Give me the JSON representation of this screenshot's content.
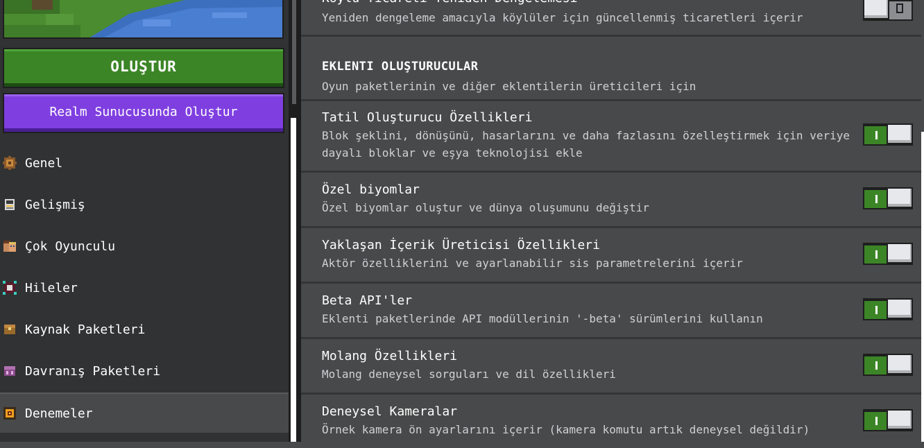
{
  "left_panel": {
    "create_button": "OLUŞTUR",
    "realm_button": "Realm Sunucusunda Oluştur",
    "nav": [
      {
        "label": "Genel",
        "icon": "gear-icon",
        "active": false
      },
      {
        "label": "Gelişmiş",
        "icon": "advanced-icon",
        "active": false
      },
      {
        "label": "Çok Oyunculu",
        "icon": "multiplayer-icon",
        "active": false
      },
      {
        "label": "Hileler",
        "icon": "cheats-icon",
        "active": false
      },
      {
        "label": "Kaynak Paketleri",
        "icon": "resource-pack-icon",
        "active": false
      },
      {
        "label": "Davranış Paketleri",
        "icon": "behavior-pack-icon",
        "active": false
      },
      {
        "label": "Denemeler",
        "icon": "experiments-icon",
        "active": true
      }
    ]
  },
  "right_panel": {
    "partial_row": {
      "title": "Köylü Ticareti Yeniden Dengelemesi",
      "desc": "Yeniden dengeleme amacıyla köylüler için güncellenmiş ticaretleri içerir",
      "enabled": false
    },
    "section": {
      "title": "EKLENTI OLUŞTURUCULAR",
      "desc": "Oyun paketlerinin ve diğer eklentilerin üreticileri için"
    },
    "rows": [
      {
        "title": "Tatil Oluşturucu Özellikleri",
        "desc1": "Blok şeklini, dönüşünü, hasarlarını ve daha fazlasını özelleştirmek için veriye",
        "desc2": "dayalı bloklar ve eşya teknolojisi ekle",
        "enabled": true
      },
      {
        "title": "Özel biyomlar",
        "desc1": "Özel biyomlar oluştur ve dünya oluşumunu değiştir",
        "enabled": true
      },
      {
        "title": "Yaklaşan İçerik Üreticisi Özellikleri",
        "desc1": "Aktör özelliklerini ve ayarlanabilir sis parametrelerini içerir",
        "enabled": true
      },
      {
        "title": "Beta API'ler",
        "desc1": "Eklenti paketlerinde API modüllerinin '-beta' sürümlerini kullanın",
        "enabled": true
      },
      {
        "title": "Molang Özellikleri",
        "desc1": "Molang deneysel sorguları ve dil özellikleri",
        "enabled": true
      },
      {
        "title": "Deneysel Kameralar",
        "desc1": "Örnek kamera ön ayarlarını içerir (kamera komutu artık deneysel değildir)",
        "enabled": true
      }
    ]
  },
  "colors": {
    "create_green": "#3c8527",
    "realm_purple": "#7f3fe0",
    "panel_dark": "#313233",
    "row_bg": "#48494a",
    "toggle_on": "#3c8527"
  }
}
